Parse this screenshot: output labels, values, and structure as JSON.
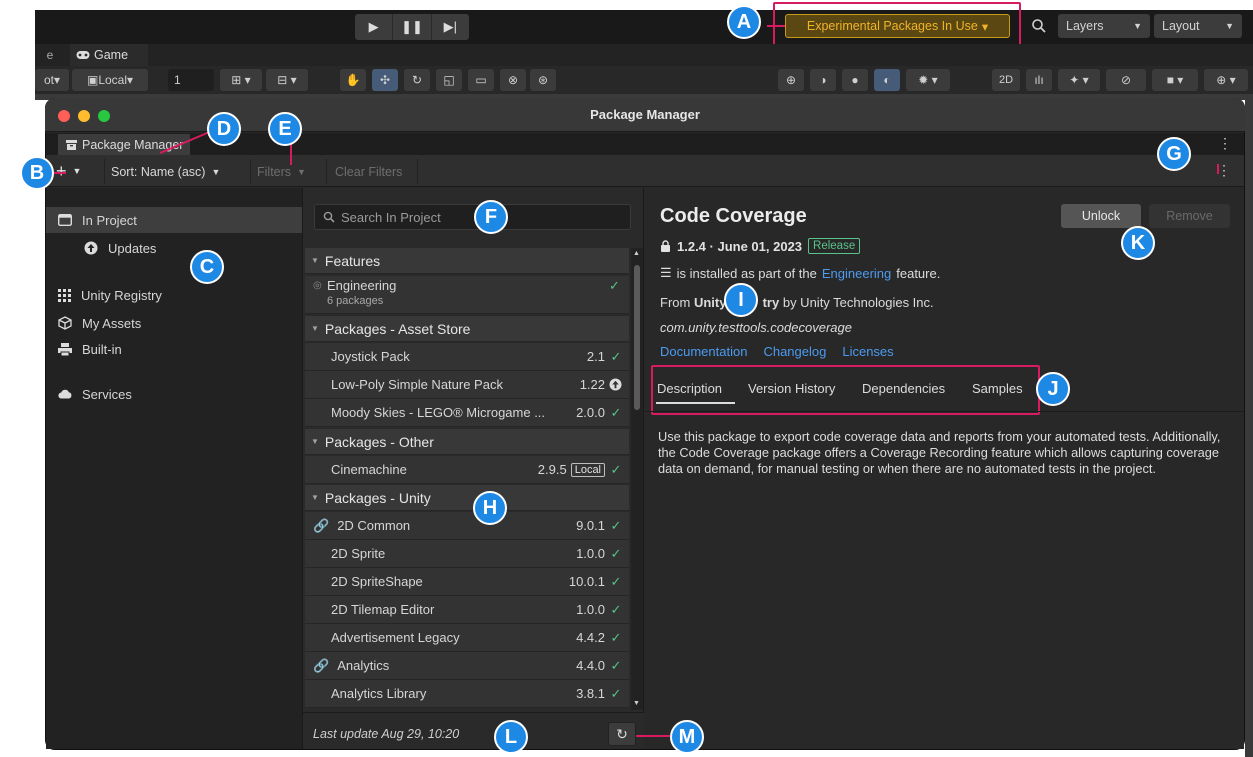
{
  "editor": {
    "experimental_label": "Experimental Packages In Use",
    "layers_label": "Layers",
    "layout_label": "Layout",
    "game_tab_label": "Game",
    "pivot_partial": "ot",
    "local_label": "Local",
    "layer_value": "1",
    "mode_2d": "2D",
    "prev_tab_partial": "e"
  },
  "window": {
    "title": "Package Manager",
    "tab_label": "Package Manager"
  },
  "toolbar": {
    "add_label": "+",
    "sort_label": "Sort: Name (asc)",
    "filters_label": "Filters",
    "clear_filters_label": "Clear Filters"
  },
  "sidebar": {
    "items": [
      {
        "label": "In Project",
        "icon": "folder-icon"
      },
      {
        "label": "Updates",
        "icon": "update-arrow-icon"
      },
      {
        "label": "Unity Registry",
        "icon": "grid-icon"
      },
      {
        "label": "My Assets",
        "icon": "cube-icon"
      },
      {
        "label": "Built-in",
        "icon": "printer-icon"
      },
      {
        "label": "Services",
        "icon": "cloud-icon"
      }
    ]
  },
  "package_list": {
    "search_placeholder": "Search In Project",
    "groups": [
      {
        "title": "Features"
      },
      {
        "title": "Packages - Asset Store"
      },
      {
        "title": "Packages - Other"
      },
      {
        "title": "Packages - Unity"
      }
    ],
    "feature": {
      "name": "Engineering",
      "sub": "6 packages"
    },
    "asset_store": [
      {
        "name": "Joystick Pack",
        "version": "2.1",
        "status": "installed"
      },
      {
        "name": "Low-Poly Simple Nature Pack",
        "version": "1.22",
        "status": "update"
      },
      {
        "name": "Moody Skies - LEGO® Microgame ...",
        "version": "2.0.0",
        "status": "installed"
      }
    ],
    "other": [
      {
        "name": "Cinemachine",
        "version": "2.9.5",
        "badge": "Local",
        "status": "installed"
      }
    ],
    "unity": [
      {
        "name": "2D Common",
        "version": "9.0.1",
        "linked": true
      },
      {
        "name": "2D Sprite",
        "version": "1.0.0"
      },
      {
        "name": "2D SpriteShape",
        "version": "10.0.1"
      },
      {
        "name": "2D Tilemap Editor",
        "version": "1.0.0"
      },
      {
        "name": "Advertisement Legacy",
        "version": "4.4.2"
      },
      {
        "name": "Analytics",
        "version": "4.4.0",
        "linked": true
      },
      {
        "name": "Analytics Library",
        "version": "3.8.1"
      }
    ],
    "last_update": "Last update Aug 29, 10:20"
  },
  "details": {
    "title": "Code Coverage",
    "unlock_label": "Unlock",
    "remove_label": "Remove",
    "version_line": "1.2.4 · June 01, 2023",
    "release_badge": "Release",
    "feature_pre": "is installed as part of the",
    "feature_link": "Engineering",
    "feature_post": "feature.",
    "from_pre": "From",
    "from_bold_a": "Unity",
    "from_bold_b": "try",
    "from_post": "by Unity Technologies Inc.",
    "package_id": "com.unity.testtools.codecoverage",
    "links": [
      "Documentation",
      "Changelog",
      "Licenses"
    ],
    "tabs": [
      "Description",
      "Version History",
      "Dependencies",
      "Samples"
    ],
    "description": "Use this package to export code coverage data and reports from your automated tests. Additionally, the Code Coverage package offers a Coverage Recording feature which allows capturing coverage data on demand, for manual testing or when there are no automated tests in the project."
  },
  "markers": [
    "A",
    "B",
    "C",
    "D",
    "E",
    "F",
    "G",
    "H",
    "I",
    "J",
    "K",
    "L",
    "M"
  ],
  "colors": {
    "marker_blue": "#1e88e5",
    "highlight_pink": "#d81b60",
    "check_green": "#58c38a",
    "link_blue": "#4c9bf0",
    "experimental_yellow": "#f0b428"
  }
}
